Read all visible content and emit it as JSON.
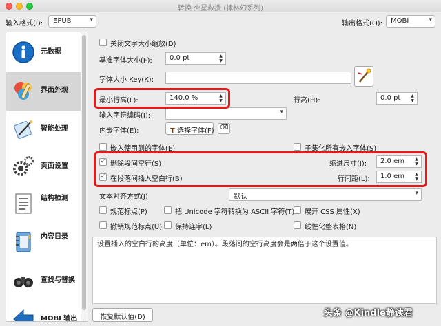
{
  "window": {
    "title": "转换 火星救援 (律林幻系列)"
  },
  "top": {
    "input_format_label": "输入格式(I):",
    "input_format_value": "EPUB",
    "output_format_label": "输出格式(O):",
    "output_format_value": "MOBI"
  },
  "sidebar": {
    "items": [
      {
        "label": "元数据",
        "icon": "info-icon"
      },
      {
        "label": "界面外观",
        "icon": "paint-icon",
        "selected": true
      },
      {
        "label": "智能处理",
        "icon": "wand-icon"
      },
      {
        "label": "页面设置",
        "icon": "gear-icon"
      },
      {
        "label": "结构检测",
        "icon": "document-icon"
      },
      {
        "label": "内容目录",
        "icon": "notebook-icon"
      },
      {
        "label": "查找与替换",
        "icon": "binoculars-icon"
      },
      {
        "label": "MOBI 输出",
        "icon": "arrow-left-icon"
      }
    ]
  },
  "form": {
    "disable_font_scaling": {
      "label": "关闭文字大小缩放(D)",
      "checked": false
    },
    "base_font_size": {
      "label": "基准字体大小(F):",
      "value": "0.0 pt"
    },
    "font_size_key": {
      "label": "字体大小 Key(K):",
      "value": ""
    },
    "min_line_height": {
      "label": "最小行高(L):",
      "value": "140.0 %"
    },
    "line_height": {
      "label": "行高(H):",
      "value": "0.0 pt"
    },
    "input_encoding": {
      "label": "输入字符编码(I):",
      "value": ""
    },
    "embed_font": {
      "label": "内嵌字体(E):",
      "button": "选择字体(F)"
    },
    "embed_used_fonts": {
      "label": "嵌入使用到的字体(E)",
      "checked": false
    },
    "subset_fonts": {
      "label": "子集化所有嵌入字体(S)",
      "checked": false
    },
    "remove_spacing": {
      "label": "删除段间空行(S)",
      "checked": true
    },
    "indent_size": {
      "label": "缩进尺寸(I):",
      "value": "2.0 em"
    },
    "insert_blank_line": {
      "label": "在段落间插入空白行(B)",
      "checked": true
    },
    "line_spacing": {
      "label": "行间距(L):",
      "value": "1.0 em"
    },
    "text_justification": {
      "label": "文本对齐方式(J)",
      "value": "默认"
    },
    "smarten_punctuation": {
      "label": "规范标点(P)",
      "checked": false
    },
    "unicode_to_ascii": {
      "label": "把 Unicode 字符转换为 ASCII 字符(T)",
      "checked": false
    },
    "expand_css": {
      "label": "展开 CSS 属性(X)",
      "checked": false
    },
    "unsmarten_punctuation": {
      "label": "撤销规范标点(U)",
      "checked": false
    },
    "keep_ligatures": {
      "label": "保持连字(L)",
      "checked": false
    },
    "linearize_tables": {
      "label": "线性化整表格(N)",
      "checked": false
    }
  },
  "description": "设置插入的空白行的高度（单位：em）。段落间的空行高度会是两倍于这个设置值。",
  "restore_defaults": "恢复默认值(D)",
  "watermark": "头条 @Kindle静读君",
  "colors": {
    "highlight": "#e11b1b",
    "selected": "#d6d6d6",
    "info_blue": "#1a6fc4"
  }
}
